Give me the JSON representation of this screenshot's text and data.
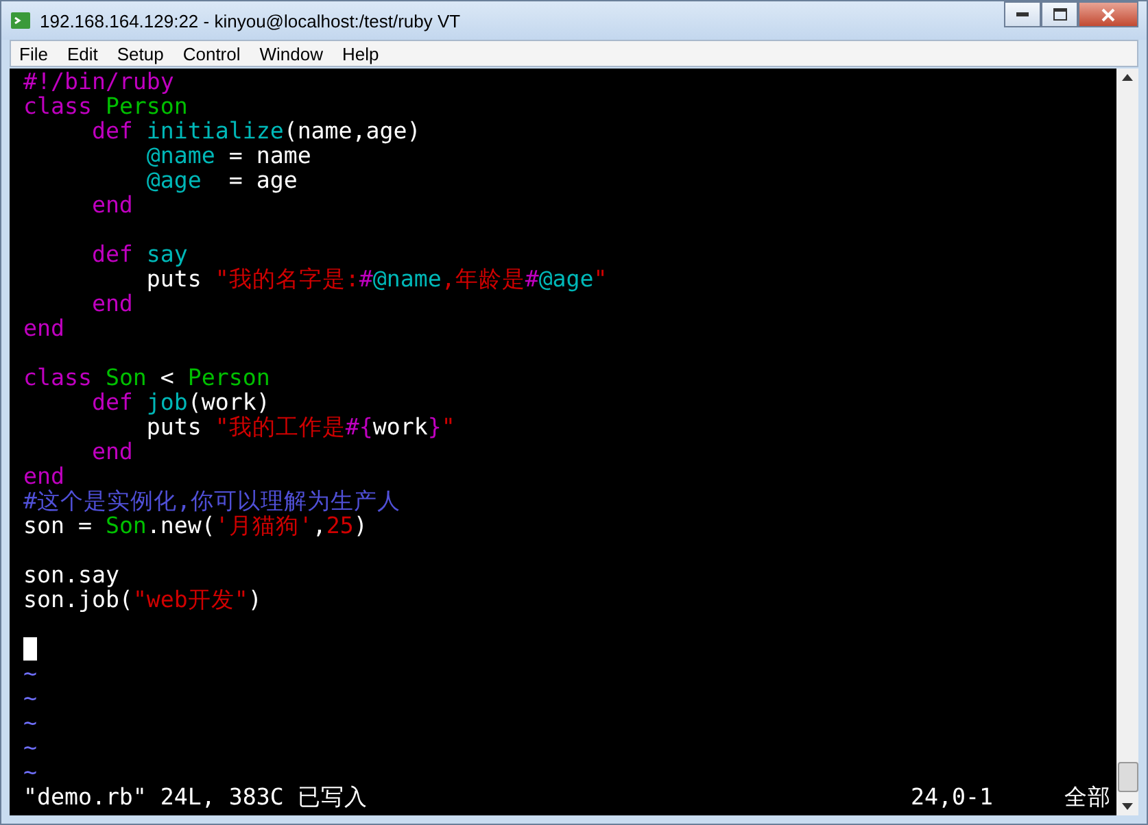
{
  "window": {
    "title": "192.168.164.129:22 - kinyou@localhost:/test/ruby VT"
  },
  "menu": [
    {
      "label": "File"
    },
    {
      "label": "Edit"
    },
    {
      "label": "Setup"
    },
    {
      "label": "Control"
    },
    {
      "label": "Window"
    },
    {
      "label": "Help"
    }
  ],
  "editor": {
    "lines": [
      {
        "kind": "code",
        "segments": [
          {
            "kind": "keyword",
            "text": "#!/bin/ruby"
          }
        ]
      },
      {
        "kind": "code",
        "segments": [
          {
            "kind": "keyword",
            "text": "class "
          },
          {
            "kind": "constant",
            "text": "Person"
          }
        ]
      },
      {
        "kind": "code",
        "segments": [
          {
            "kind": "keyword",
            "text": "     def "
          },
          {
            "kind": "ident",
            "text": "initialize"
          },
          {
            "kind": "plain",
            "text": "(name,age)"
          }
        ]
      },
      {
        "kind": "code",
        "segments": [
          {
            "kind": "ident",
            "text": "         @name"
          },
          {
            "kind": "plain",
            "text": " = name"
          }
        ]
      },
      {
        "kind": "code",
        "segments": [
          {
            "kind": "ident",
            "text": "         @age"
          },
          {
            "kind": "plain",
            "text": "  = age"
          }
        ]
      },
      {
        "kind": "code",
        "segments": [
          {
            "kind": "keyword",
            "text": "     end"
          }
        ]
      },
      {
        "kind": "blank"
      },
      {
        "kind": "code",
        "segments": [
          {
            "kind": "keyword",
            "text": "     def "
          },
          {
            "kind": "ident",
            "text": "say"
          }
        ]
      },
      {
        "kind": "code",
        "segments": [
          {
            "kind": "plain",
            "text": "         puts "
          },
          {
            "kind": "string",
            "text": "\"我的名字是:"
          },
          {
            "kind": "keyword",
            "text": "#"
          },
          {
            "kind": "ident",
            "text": "@name"
          },
          {
            "kind": "string",
            "text": ",年龄是"
          },
          {
            "kind": "keyword",
            "text": "#"
          },
          {
            "kind": "ident",
            "text": "@age"
          },
          {
            "kind": "string",
            "text": "\""
          }
        ]
      },
      {
        "kind": "code",
        "segments": [
          {
            "kind": "keyword",
            "text": "     end"
          }
        ]
      },
      {
        "kind": "code",
        "segments": [
          {
            "kind": "keyword",
            "text": "end"
          }
        ]
      },
      {
        "kind": "blank"
      },
      {
        "kind": "code",
        "segments": [
          {
            "kind": "keyword",
            "text": "class "
          },
          {
            "kind": "constant",
            "text": "Son"
          },
          {
            "kind": "plain",
            "text": " < "
          },
          {
            "kind": "constant",
            "text": "Person"
          }
        ]
      },
      {
        "kind": "code",
        "segments": [
          {
            "kind": "keyword",
            "text": "     def "
          },
          {
            "kind": "ident",
            "text": "job"
          },
          {
            "kind": "plain",
            "text": "(work)"
          }
        ]
      },
      {
        "kind": "code",
        "segments": [
          {
            "kind": "plain",
            "text": "         puts "
          },
          {
            "kind": "string",
            "text": "\"我的工作是"
          },
          {
            "kind": "keyword",
            "text": "#{"
          },
          {
            "kind": "plain",
            "text": "work"
          },
          {
            "kind": "keyword",
            "text": "}"
          },
          {
            "kind": "string",
            "text": "\""
          }
        ]
      },
      {
        "kind": "code",
        "segments": [
          {
            "kind": "keyword",
            "text": "     end"
          }
        ]
      },
      {
        "kind": "code",
        "segments": [
          {
            "kind": "keyword",
            "text": "end"
          }
        ]
      },
      {
        "kind": "code",
        "segments": [
          {
            "kind": "comment",
            "text": "#这个是实例化,你可以理解为生产人"
          }
        ]
      },
      {
        "kind": "code",
        "segments": [
          {
            "kind": "plain",
            "text": "son = "
          },
          {
            "kind": "constant",
            "text": "Son"
          },
          {
            "kind": "plain",
            "text": ".new("
          },
          {
            "kind": "string",
            "text": "'月猫狗'"
          },
          {
            "kind": "plain",
            "text": ","
          },
          {
            "kind": "string",
            "text": "25"
          },
          {
            "kind": "plain",
            "text": ")"
          }
        ]
      },
      {
        "kind": "blank"
      },
      {
        "kind": "code",
        "segments": [
          {
            "kind": "plain",
            "text": "son.say"
          }
        ]
      },
      {
        "kind": "code",
        "segments": [
          {
            "kind": "plain",
            "text": "son.job("
          },
          {
            "kind": "string",
            "text": "\"web开发\""
          },
          {
            "kind": "plain",
            "text": ")"
          }
        ]
      },
      {
        "kind": "blank"
      },
      {
        "kind": "cursor"
      },
      {
        "kind": "tilde",
        "text": "~"
      },
      {
        "kind": "tilde",
        "text": "~"
      },
      {
        "kind": "tilde",
        "text": "~"
      },
      {
        "kind": "tilde",
        "text": "~"
      },
      {
        "kind": "tilde",
        "text": "~"
      }
    ],
    "status": {
      "message": "\"demo.rb\" 24L, 383C 已写入",
      "position": "24,0-1",
      "scroll": "全部"
    }
  }
}
